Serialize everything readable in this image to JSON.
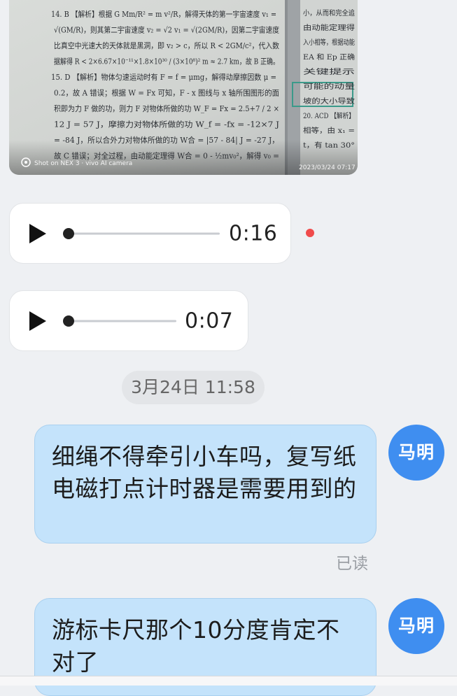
{
  "photo": {
    "alt": "photo of answer-key textbook page",
    "lines": [
      "14. B 【解析】根据 G Mm/R² = m v²/R，解得天体的第一宇宙速度 v₁ =",
      "√(GM/R)，则其第二宇宙速度 v₂ = √2 v₁ = √(2GM/R)，因第二宇宙速度",
      "比真空中光速大的天体就是黑洞，即 v₂ > c，所以 R < 2GM/c²，代入数",
      "据解得 R < 2×6.67×10⁻¹¹×1.8×10³⁰ / (3×10⁸)² m ≈ 2.7 km，故 B 正确。",
      "15. D 【解析】物体匀速运动时有 F = f = μmg，解得动摩擦因数 μ =",
      "0.2，故 A 错误；根据 W = Fx 可知，F - x 图线与 x 轴所围图形的面",
      "积即为力 F 做的功，则力 F 对物体所做的功 W_F = Fx = 2.5+7 / 2 ×",
      "12 J = 57 J，摩擦力对物体所做的功 W_f = -fx = -12×7 J",
      "= -84 J，所以合外力对物体所做的功 W合 = |57 - 84| J = -27 J，",
      "故 C 错误；对全过程，由动能定理得 W合 = 0 - ½mv₀²，解得 v₀ ="
    ],
    "right_lines": [
      "小，从而和完全追",
      "由动能定理得",
      "入小相等，根据动能",
      "EA 和 Ep 正确",
      "关键提示",
      "可能的动量",
      "坡的大小导致",
      "20. ACD 【解析】",
      "相等，由 x₁ = ",
      "t，有 tan 30°"
    ],
    "watermark": "Shot on NEX 3 · vivo AI camera",
    "stamp": "2023/03/24 07:17"
  },
  "voice_messages": [
    {
      "duration": "0:16",
      "progress": 0.0,
      "unread": true
    },
    {
      "duration": "0:07",
      "progress": 0.0,
      "unread": false
    }
  ],
  "timestamp": "3月24日 11:58",
  "messages": [
    {
      "text": "细绳不得牵引小车吗，复写纸电磁打点计时器是需要用到的",
      "sender": "马明",
      "status": "已读"
    },
    {
      "text": "游标卡尺那个10分度肯定不对了",
      "sender": "马明"
    }
  ],
  "colors": {
    "bubble": "#c4e3fb",
    "avatar": "#3f8ef0",
    "unread_dot": "#f04b4b"
  }
}
